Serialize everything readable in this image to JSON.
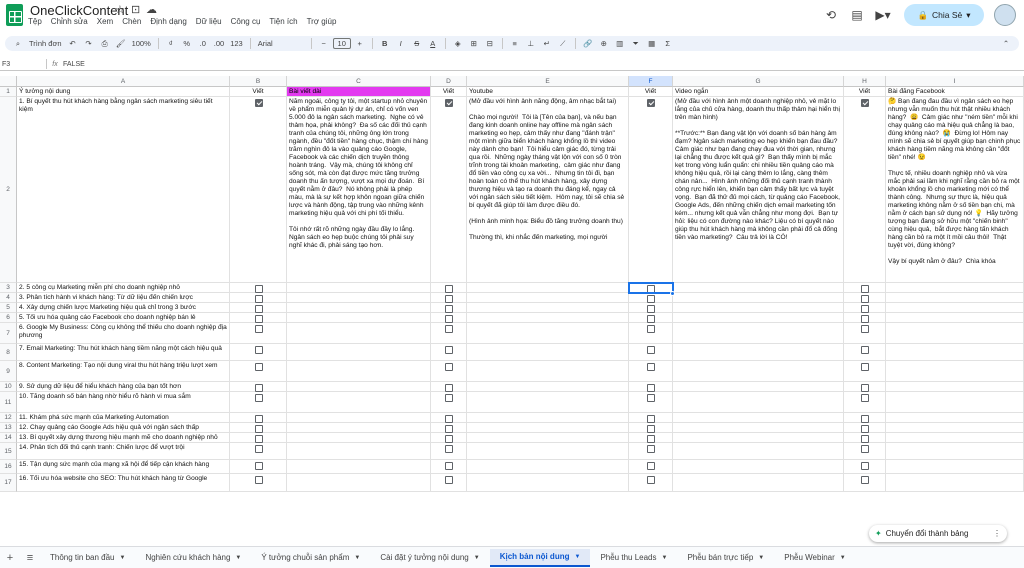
{
  "doc": {
    "title": "OneClickContent"
  },
  "menu": [
    "Tệp",
    "Chỉnh sửa",
    "Xem",
    "Chèn",
    "Định dạng",
    "Dữ liệu",
    "Công cụ",
    "Tiện ích",
    "Trợ giúp"
  ],
  "share": {
    "label": "Chia Sẻ"
  },
  "toolbar": {
    "search": "Trình đơn",
    "zoom": "100%",
    "percent": "%",
    "decimal1": ".0",
    "decimal2": ".00",
    "numfmt": "123",
    "font": "Arial",
    "fontsize": "10",
    "currency": "₫"
  },
  "formula": {
    "cell": "F3",
    "fx": "fx",
    "value": "FALSE"
  },
  "columns": [
    "A",
    "B",
    "C",
    "D",
    "E",
    "F",
    "G",
    "H",
    "I"
  ],
  "selected_column": "F",
  "row_numbers": [
    "1",
    "2",
    "3",
    "4",
    "5",
    "6",
    "7",
    "8",
    "9",
    "10",
    "11",
    "12",
    "13",
    "14",
    "15",
    "16",
    "17"
  ],
  "row1": {
    "a": "Ý tưởng nội dung",
    "b": "Viết",
    "c": "Bài viết dài",
    "d": "Viết",
    "e": "Youtube",
    "f": "Viết",
    "g": "Video ngắn",
    "h": "Viết",
    "i": "Bài đăng Facebook"
  },
  "row2": {
    "a": "1. Bí quyết thu hút khách hàng bằng ngân sách marketing siêu tiết kiệm",
    "c": "Năm ngoái, công ty tôi, một startup nhỏ chuyên về phẩm miễn quản lý dự án, chỉ có vốn ven 5.000 đô la ngân sách marketing.  Nghe có vẻ thảm họa, phải không?  Đa số các đối thủ cạnh tranh của chúng tôi, những ông lớn trong ngành, đều \"đốt tiền\" hàng chục, thậm chí hàng trăm nghìn đô la vào quảng cáo Google, Facebook và các chiến dịch truyền thông hoành tráng.  Vậy mà, chúng tôi không chỉ sống sót, mà còn đạt được mức tăng trưởng doanh thu ấn tượng, vượt xa mọi dự đoán.  Bí quyết nằm ở đâu?  Nó không phải là phép màu, mà là sự kết hợp khôn ngoan giữa chiến lược và hành động, tập trung vào những kênh marketing hiệu quả với chi phí tối thiểu.\n\nTôi nhớ rất rõ những ngày đầu đầy lo lắng.  Ngân sách eo hẹp buộc chúng tôi phải suy nghĩ khác đi, phải sáng tạo hơn.",
    "e": "(Mở đầu với hình ảnh năng động, âm nhạc bắt tai)\n\nChào mọi người!  Tôi là [Tên của bạn], và nếu bạn đang kinh doanh online hay offline mà ngân sách marketing eo hẹp, cảm thấy như đang \"đánh trận\" một mình giữa biển khách hàng khổng lồ thì video này dành cho bạn!  Tôi hiểu cảm giác đó, từng trải qua rồi.  Những ngày tháng vật lộn với con số 0 tròn trĩnh trong tài khoản marketing,  cảm giác như đang đổ tiền vào công cụ xa vời...  Nhưng tin tôi đi, bạn hoàn toàn có thể thu hút khách hàng, xây dựng thương hiệu và tạo ra doanh thu đáng kể, ngay cả với ngân sách siêu tiết kiệm.  Hôm nay, tôi sẽ chia sẻ bí quyết đã giúp tôi làm được điều đó.\n\n(Hình ảnh minh họa: Biểu đồ tăng trưởng doanh thu)\n\nThường thì, khi nhắc đến marketing, mọi người",
    "g": "(Mở đầu với hình ảnh một doanh nghiệp nhỏ, vẻ mặt lo lắng của chủ cửa hàng, doanh thu thấp thảm hại hiển thị trên màn hình)\n\n**Trước:** Bạn đang vật lộn với doanh số bán hàng ảm đạm? Ngân sách marketing eo hẹp khiến bạn đau đầu?  Cảm giác như bạn đang chạy đua với thời gian, nhưng lại chẳng thu được kết quả gì?  Bạn thấy mình bị mắc kẹt trong vòng luẩn quẩn: chi nhiều tiền quảng cáo mà không hiệu quả, rồi lại càng thêm lo lắng, càng thêm chán nản...  Hình ảnh những đối thủ cạnh tranh thành công rực hiển lên, khiến bạn cảm thấy bất lực và tuyệt vọng.  Bạn đã thử đủ mọi cách, từ quảng cáo Facebook, Google Ads, đến những chiến dịch email marketing tốn kém... nhưng kết quả vẫn chẳng như mong đợi.  Bạn tự hỏi: liệu có con đường nào khác? Liệu có bí quyết nào giúp thu hút khách hàng mà không cần phải đổ cả đống tiền vào marketing?  Câu trả lời là CÓ!",
    "i": "🤔 Bạn đang đau đầu vì ngân sách eo hẹp nhưng vẫn muốn thu hút thật nhiều khách hàng?  😩  Cảm giác như \"ném tiền\" mỗi khi chạy quảng cáo mà hiệu quả chẳng là bao, đúng không nào?  😭  Đừng lo! Hôm nay mình sẽ chia sẻ bí quyết giúp bạn chinh phục khách hàng tiềm năng mà không cần \"đốt tiền\" nhé! 😉\n\nThực tế, nhiều doanh nghiệp nhỏ và vừa mắc phải sai lầm khi nghĩ rằng cần bỏ ra một khoản khổng lồ cho marketing mới có thể thành công.  Nhưng sự thực là, hiệu quả marketing không nằm ở số tiền bạn chi, mà nằm ở cách bạn sử dụng nó! 💡  Hãy tưởng tượng bạn đang sở hữu một \"chiến binh\" cùng hiệu quả,  bắt được hàng tấn khách hàng cần bỏ ra một ít mồi câu thôi!  Thật tuyệt vời, đúng không?\n\nVậy bí quyết nằm ở đâu?  Chìa khóa"
  },
  "ideas": [
    "2. 5 công cụ Marketing miễn phí cho doanh nghiệp nhỏ",
    "3. Phân tích hành vi khách hàng: Từ dữ liệu đến chiến lược",
    "4. Xây dựng chiến lược Marketing hiệu quả chỉ trong 3 bước",
    "5. Tối ưu hóa quảng cáo Facebook cho doanh nghiệp bán lẻ",
    "6. Google My Business: Công cụ không thể thiếu cho doanh nghiệp địa phương",
    "7. Email Marketing: Thu hút khách hàng tiềm năng một cách hiệu quả",
    "8. Content Marketing: Tạo nội dung viral thu hút hàng triệu lượt xem",
    "9. Sử dụng dữ liệu để hiểu khách hàng của bạn tốt hơn",
    "10. Tăng doanh số bán hàng nhờ hiểu rõ hành vi mua sắm",
    "11. Khám phá sức mạnh của Marketing Automation",
    "12. Chạy quảng cáo Google Ads hiệu quả với ngân sách thấp",
    "13. Bí quyết xây dựng thương hiệu mạnh mẽ cho doanh nghiệp nhỏ",
    "14. Phân tích đối thủ cạnh tranh: Chiến lược để vượt trội",
    "15. Tận dụng sức mạnh của mạng xã hội để tiếp cận khách hàng",
    "16. Tối ưu hóa website cho SEO: Thu hút khách hàng từ Google"
  ],
  "sheets": [
    "Thông tin ban đầu",
    "Nghiên cứu khách hàng",
    "Ý tưởng chuỗi sản phẩm",
    "Cài đặt ý tưởng nội dung",
    "Kịch bản nội dung",
    "Phễu thu Leads",
    "Phễu bán trực tiếp",
    "Phễu Webinar"
  ],
  "active_sheet": "Kịch bản nội dung",
  "toast": {
    "label": "Chuyển đổi thành bảng"
  },
  "colors": {
    "accent": "#1a73e8",
    "highlight": "#e33af0",
    "share": "#c2e7ff",
    "sheets_green": "#0f9d58"
  }
}
